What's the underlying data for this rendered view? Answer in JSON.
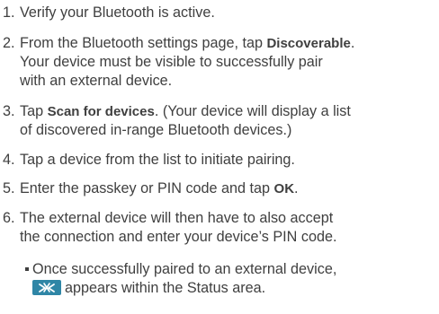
{
  "steps": [
    {
      "num": "1.",
      "lines": [
        {
          "parts": [
            {
              "text": "Verify your Bluetooth is active.",
              "bold": false
            }
          ]
        }
      ]
    },
    {
      "num": "2.",
      "lines": [
        {
          "parts": [
            {
              "text": "From the Bluetooth settings page, tap ",
              "bold": false
            },
            {
              "text": "Discoverable",
              "bold": true
            },
            {
              "text": ".",
              "bold": false
            }
          ]
        },
        {
          "parts": [
            {
              "text": "Your device must be visible to successfully pair",
              "bold": false
            }
          ]
        },
        {
          "parts": [
            {
              "text": "with an external device.",
              "bold": false
            }
          ]
        }
      ]
    },
    {
      "num": "3.",
      "lines": [
        {
          "parts": [
            {
              "text": "Tap ",
              "bold": false
            },
            {
              "text": "Scan for devices",
              "bold": true
            },
            {
              "text": ". (Your device will display a list",
              "bold": false
            }
          ]
        },
        {
          "parts": [
            {
              "text": "of discovered in-range Bluetooth devices.)",
              "bold": false
            }
          ]
        }
      ]
    },
    {
      "num": "4.",
      "lines": [
        {
          "parts": [
            {
              "text": "Tap a device from the list to initiate pairing.",
              "bold": false
            }
          ]
        }
      ]
    },
    {
      "num": "5.",
      "lines": [
        {
          "parts": [
            {
              "text": "Enter the passkey or PIN code and tap ",
              "bold": false
            },
            {
              "text": "OK",
              "bold": true
            },
            {
              "text": ".",
              "bold": false
            }
          ]
        }
      ]
    },
    {
      "num": "6.",
      "lines": [
        {
          "parts": [
            {
              "text": "The external device will then have to also accept",
              "bold": false
            }
          ]
        },
        {
          "parts": [
            {
              "text": "the connection and enter your device’s PIN code.",
              "bold": false
            }
          ]
        }
      ]
    }
  ],
  "bullet": {
    "line1": "Once successfully paired to an external device,",
    "line2": "appears within the Status area.",
    "icon": "bluetooth-connected-icon",
    "icon_color": "#2f86a6"
  },
  "colors": {
    "text": "#3f3f3f"
  }
}
